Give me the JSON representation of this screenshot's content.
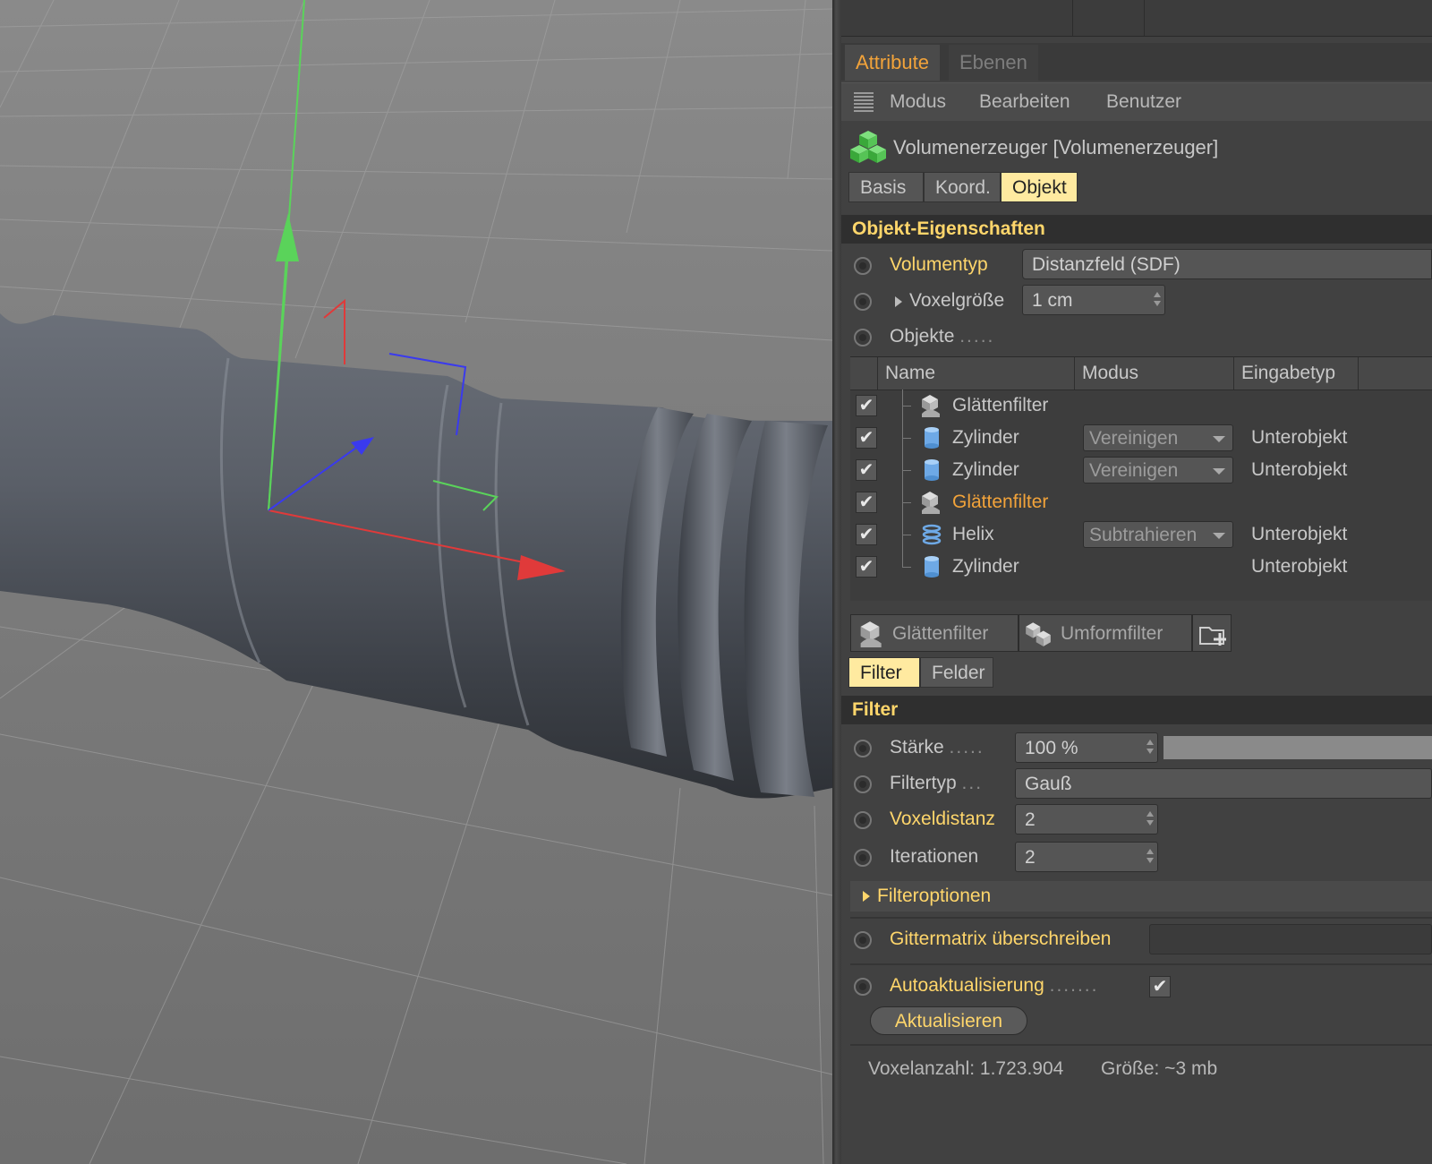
{
  "attribute_manager": {
    "tabs": [
      {
        "label": "Attribute",
        "active": true
      },
      {
        "label": "Ebenen",
        "active": false
      }
    ],
    "menu": {
      "grid_icon": "grid-icon",
      "items": [
        "Modus",
        "Bearbeiten",
        "Benutzer"
      ]
    },
    "object": {
      "icon": "volume-builder-icon",
      "title": "Volumenerzeuger [Volumenerzeuger]"
    },
    "subtabs": [
      "Basis",
      "Koord.",
      "Objekt"
    ],
    "selected_subtab": "Objekt",
    "section_object": "Objekt-Eigenschaften",
    "volumentyp": {
      "label": "Volumentyp",
      "value": "Distanzfeld (SDF)"
    },
    "voxelgroesse": {
      "label": "Voxelgröße",
      "value": "1 cm"
    },
    "objekte": {
      "label": "Objekte",
      "dots": "....."
    },
    "table": {
      "headers": [
        "Name",
        "Modus",
        "Eingabetyp"
      ],
      "rows": [
        {
          "name": "Glättenfilter",
          "icon": "smooth-filter-icon",
          "modus": "",
          "eingabe": "",
          "checked": "✔",
          "selected": false,
          "indent": 0
        },
        {
          "name": "Zylinder",
          "icon": "cylinder-icon",
          "modus": "Vereinigen",
          "eingabe": "Unterobjekt",
          "checked": "✔",
          "selected": false,
          "indent": 0
        },
        {
          "name": "Zylinder",
          "icon": "cylinder-icon",
          "modus": "Vereinigen",
          "eingabe": "Unterobjekt",
          "checked": "✔",
          "selected": false,
          "indent": 0
        },
        {
          "name": "Glättenfilter",
          "icon": "smooth-filter-icon",
          "modus": "",
          "eingabe": "",
          "checked": "✔",
          "selected": true,
          "indent": 0
        },
        {
          "name": "Helix",
          "icon": "helix-icon",
          "modus": "Subtrahieren",
          "eingabe": "Unterobjekt",
          "checked": "✔",
          "selected": false,
          "indent": 0
        },
        {
          "name": "Zylinder",
          "icon": "cylinder-icon",
          "modus": "",
          "eingabe": "Unterobjekt",
          "checked": "✔",
          "selected": false,
          "indent": 0
        }
      ]
    },
    "filter_buttons": [
      {
        "label": "Glättenfilter",
        "icon": "smooth-filter-icon"
      },
      {
        "label": "Umformfilter",
        "icon": "reshape-filter-icon"
      },
      {
        "label": "",
        "icon": "add-folder-icon"
      }
    ],
    "filter_tabs": [
      "Filter",
      "Felder"
    ],
    "selected_filter_tab": "Filter",
    "section_filter": "Filter",
    "staerke": {
      "label": "Stärke",
      "dots": ".....",
      "value": "100 %",
      "fraction": 1.0
    },
    "filtertyp": {
      "label": "Filtertyp",
      "dots": "...",
      "value": "Gauß"
    },
    "voxeldistanz": {
      "label": "Voxeldistanz",
      "value": "2"
    },
    "iterationen": {
      "label": "Iterationen",
      "value": "2"
    },
    "filteroptionen": "Filteroptionen",
    "gittermatrix": {
      "label": "Gittermatrix überschreiben",
      "value": ""
    },
    "autoaktualisierung": {
      "label": "Autoaktualisierung",
      "dots": ".......",
      "checked": "✔"
    },
    "aktualisieren": "Aktualisieren",
    "status": {
      "voxels": "Voxelanzahl: 1.723.904",
      "size": "Größe: ~3 mb"
    }
  },
  "colors": {
    "accent": "#f2a33a",
    "label_yellow": "#ffd66b",
    "selected_tab": "#ffeaa0",
    "axis_x": "#e03a3a",
    "axis_y": "#5ad35a",
    "axis_z": "#3a3aee"
  }
}
